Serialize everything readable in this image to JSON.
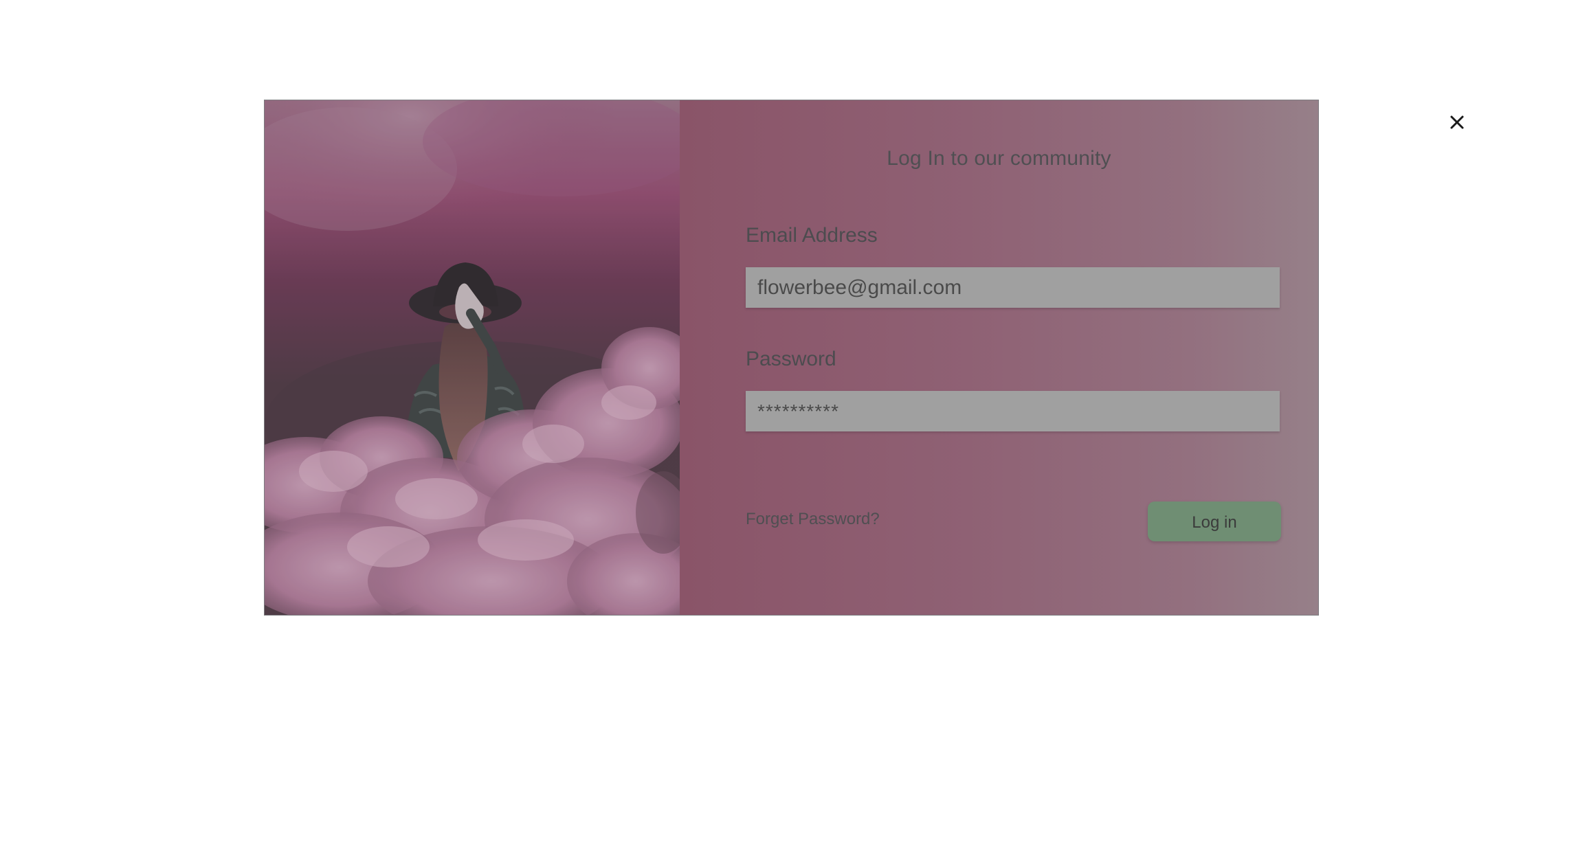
{
  "modal": {
    "title": "Log In to our community",
    "close_icon": "close-icon",
    "photo": {
      "description_icon": "photo-woman-in-pink-smoke"
    },
    "email": {
      "label": "Email Address",
      "value": "flowerbee@gmail.com"
    },
    "password": {
      "label": "Password",
      "value": "**********"
    },
    "forgot_password": "Forget Password?",
    "login_button": "Log in"
  },
  "colors": {
    "panel_gradient_start": "#8a5468",
    "panel_gradient_end": "#968089",
    "input_background": "#a0a0a0",
    "login_button": "#6f8e73",
    "text": "#4f4f52"
  }
}
